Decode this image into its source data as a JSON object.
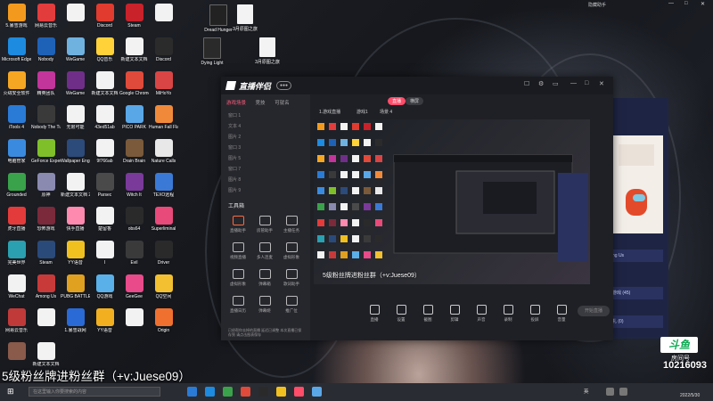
{
  "top_right": {
    "label": "隐藏助手",
    "controls": [
      "—",
      "□",
      "✕"
    ]
  },
  "desktop_icons": [
    {
      "label": "5.暴雪游戏",
      "color": "#f39a1e"
    },
    {
      "label": "网易云音乐",
      "color": "#e23c3c"
    },
    {
      "label": "",
      "color": "#f2f2f2"
    },
    {
      "label": "Discord",
      "color": "#e03b2e"
    },
    {
      "label": "Steam",
      "color": "#c9222a"
    },
    {
      "label": "",
      "color": "#f2f2f2"
    },
    {
      "label": "Microsoft Edge",
      "color": "#1d8be0"
    },
    {
      "label": "Nobody",
      "color": "#1e62b8"
    },
    {
      "label": "WeGame",
      "color": "#6fb2e0"
    },
    {
      "label": "QQ音乐",
      "color": "#ffd23a"
    },
    {
      "label": "新建文本文档",
      "color": "#f2f2f2"
    },
    {
      "label": "Discord",
      "color": "#2b2b2b"
    },
    {
      "label": "火绒安全软件",
      "color": "#f5a623"
    },
    {
      "label": "精英团队",
      "color": "#c2359a"
    },
    {
      "label": "WeGame",
      "color": "#6f2f88"
    },
    {
      "label": "新建文本文档",
      "color": "#f2f2f2"
    },
    {
      "label": "Google Chrome",
      "color": "#e04a3a"
    },
    {
      "label": "MiHoYo",
      "color": "#d94545"
    },
    {
      "label": "iTools 4",
      "color": "#2a7bd6"
    },
    {
      "label": "Nobody The Turnaround",
      "color": "#3a3a3a"
    },
    {
      "label": "无限可能",
      "color": "#f2f2f2"
    },
    {
      "label": "43ed51ab",
      "color": "#f2f2f2"
    },
    {
      "label": "PICO PARK",
      "color": "#5aa7e8"
    },
    {
      "label": "Human Fall Flat",
      "color": "#f08a3a"
    },
    {
      "label": "电脑管家",
      "color": "#3a8be0"
    },
    {
      "label": "GeForce Experience",
      "color": "#7fbf2a"
    },
    {
      "label": "Wallpaper Engine",
      "color": "#2c4a7a"
    },
    {
      "label": "9f766ab",
      "color": "#f2f2f2"
    },
    {
      "label": "Drain Brain",
      "color": "#7a5a3a"
    },
    {
      "label": "Nature Calls",
      "color": "#e8e8e8"
    },
    {
      "label": "Grounded",
      "color": "#3aa24a"
    },
    {
      "label": "原神",
      "color": "#8a8ab0"
    },
    {
      "label": "新建文本文档 20210908",
      "color": "#f2f2f2"
    },
    {
      "label": "Parsec",
      "color": "#4a4a4a"
    },
    {
      "label": "Witch It",
      "color": "#7a3a9a"
    },
    {
      "label": "TEXO远程",
      "color": "#3a7ad6"
    },
    {
      "label": "虎牙直播",
      "color": "#e33b3b"
    },
    {
      "label": "恐怖游戏",
      "color": "#7a2a3a"
    },
    {
      "label": "快手直播",
      "color": "#ff8ab0"
    },
    {
      "label": "楚留香",
      "color": "#f2f2f2"
    },
    {
      "label": "obs64",
      "color": "#2a2a2a"
    },
    {
      "label": "Superliminal",
      "color": "#e84a7a"
    },
    {
      "label": "完美世界",
      "color": "#2aa0b0"
    },
    {
      "label": "Steam",
      "color": "#2a4a7a"
    },
    {
      "label": "YY语音",
      "color": "#f0c020"
    },
    {
      "label": "I",
      "color": "#f2f2f2"
    },
    {
      "label": "Evil",
      "color": "#3a3a3a"
    },
    {
      "label": "Driver",
      "color": "#2a2a2a"
    },
    {
      "label": "WeChat",
      "color": "#f2f2f2"
    },
    {
      "label": "Among Us",
      "color": "#c83a3a"
    },
    {
      "label": "PUBG BATTLEGROUNDS",
      "color": "#e0a020"
    },
    {
      "label": "QQ游戏",
      "color": "#5ab0e8"
    },
    {
      "label": "GeeGee",
      "color": "#e84a8a"
    },
    {
      "label": "QQ空间",
      "color": "#f2c030"
    },
    {
      "label": "网易云音乐",
      "color": "#c03a3a"
    },
    {
      "label": "",
      "color": "#f2f2f2"
    },
    {
      "label": "1.暴雪战网",
      "color": "#2a6ad6"
    },
    {
      "label": "YY语音",
      "color": "#f2b020"
    },
    {
      "label": "",
      "color": "#f2f2f2"
    },
    {
      "label": "Origin",
      "color": "#f07030"
    },
    {
      "label": "",
      "color": "#8a5a4a"
    },
    {
      "label": "新建文本文档",
      "color": "#f2f2f2"
    }
  ],
  "top_files": [
    {
      "label": "Dread Hunger"
    },
    {
      "label": "3月原图之旅"
    },
    {
      "label": "Dying Light"
    },
    {
      "label": "3月原图之旅"
    }
  ],
  "app": {
    "logo": "直播伴侣",
    "badge": "●●●",
    "window_controls": [
      "☐",
      "⚙",
      "▭",
      "—",
      "□",
      "✕"
    ],
    "sidebar_tabs": [
      "游戏场景",
      "竞技",
      "可就名"
    ],
    "sidebar_rows": [
      "窗口 1",
      "文本 4",
      "图片 2",
      "窗口 3",
      "图片 5",
      "窗口 7",
      "图片 8",
      "图片 9"
    ],
    "scene_tabs": [
      "1.游戏直播",
      "游戏1",
      "场景 4"
    ],
    "rec_buttons": [
      "直播",
      "横屏"
    ],
    "tools_title": "工具箱",
    "tools": [
      {
        "label": "直播助手",
        "hot": true
      },
      {
        "label": "房管助手",
        "hot": false
      },
      {
        "label": "主播任务",
        "hot": false
      },
      {
        "label": "视频直播",
        "hot": false
      },
      {
        "label": "多人连麦",
        "hot": false
      },
      {
        "label": "虚拟形象",
        "hot": false
      },
      {
        "label": "虚拟形象",
        "hot": false
      },
      {
        "label": "弹幕箱",
        "hot": false
      },
      {
        "label": "歌词助手",
        "hot": false
      },
      {
        "label": "直播日历",
        "hot": false
      },
      {
        "label": "弹幕姬",
        "hot": false
      },
      {
        "label": "推广位",
        "hot": false
      }
    ],
    "tool_note": "已经帮你去掉的直播 延迟已调整 本次直播已保存到 请点击图表保存",
    "bottom_buttons": [
      "直播",
      "设置",
      "截图",
      "剪辑",
      "声音",
      "录制",
      "投屏",
      "音量"
    ],
    "go_live": "开始直播",
    "preview_text": "5级粉丝牌进粉丝群（+v:Juese09）"
  },
  "right_panel": {
    "rows": [
      "游戏 (45)",
      "礼 (0)",
      "ng Us"
    ]
  },
  "subtitle": "5级粉丝牌进粉丝群（+v:Juese09）",
  "watermark": {
    "logo": "斗鱼",
    "sub": "房间号",
    "number": "10216093"
  },
  "taskbar": {
    "search_placeholder": "在这里输入你要搜索的内容",
    "tray_text": "英",
    "date": "2022/5/30"
  }
}
